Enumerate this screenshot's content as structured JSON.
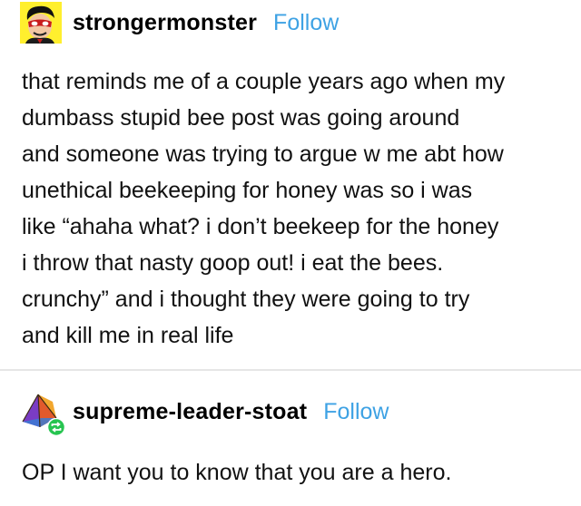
{
  "posts": [
    {
      "username": "strongermonster",
      "follow_label": "Follow",
      "avatar_icon": "cartoon-avatar-icon",
      "body_lines": [
        "that reminds me of a couple years ago when my",
        "dumbass stupid bee post was going around",
        "and someone was trying to argue w me abt how",
        "unethical beekeeping for honey was so i was",
        "like “ahaha what? i don’t beekeep for the honey",
        "i throw that nasty goop out! i eat the bees.",
        "crunchy” and i thought they were going to try",
        "and kill me in real life"
      ]
    },
    {
      "username": "supreme-leader-stoat",
      "follow_label": "Follow",
      "avatar_icon": "pyramid-avatar-icon",
      "reblog_badge_icon": "reblog-icon",
      "body_lines": [
        "OP I want you to know that you are a hero."
      ]
    }
  ],
  "colors": {
    "follow": "#3ea2e4",
    "reblog_badge": "#27c450",
    "divider": "#e6e6e6",
    "avatar_1_bg": "#ffef2e"
  }
}
